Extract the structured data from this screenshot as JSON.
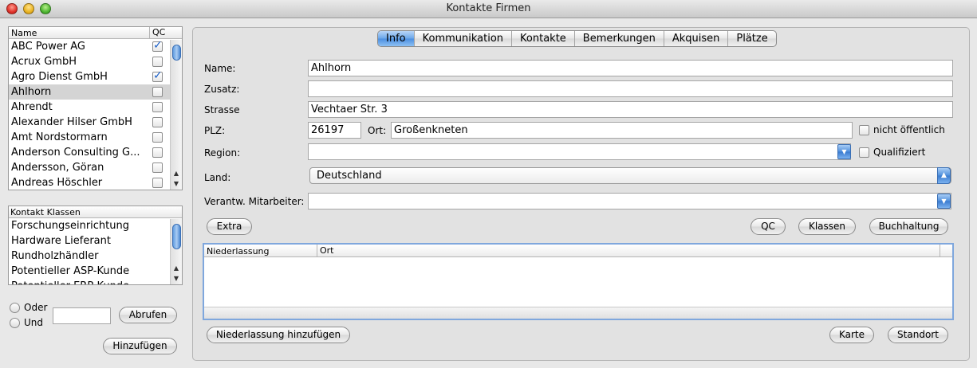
{
  "window": {
    "title": "Kontakte Firmen"
  },
  "companies": {
    "col_name": "Name",
    "col_qc": "QC",
    "rows": [
      {
        "name": "ABC Power AG",
        "qc": true,
        "selected": false
      },
      {
        "name": "Acrux GmbH",
        "qc": false,
        "selected": false
      },
      {
        "name": "Agro Dienst GmbH",
        "qc": true,
        "selected": false
      },
      {
        "name": "Ahlhorn",
        "qc": false,
        "selected": true
      },
      {
        "name": "Ahrendt",
        "qc": false,
        "selected": false
      },
      {
        "name": "Alexander Hilser GmbH",
        "qc": false,
        "selected": false
      },
      {
        "name": "Amt Nordstormarn",
        "qc": false,
        "selected": false
      },
      {
        "name": "Anderson Consulting G...",
        "qc": false,
        "selected": false
      },
      {
        "name": "Andersson, Göran",
        "qc": false,
        "selected": false
      },
      {
        "name": "Andreas Höschler",
        "qc": false,
        "selected": false
      }
    ]
  },
  "classes": {
    "header": "Kontakt Klassen",
    "rows": [
      "Forschungseinrichtung",
      "Hardware Lieferant",
      "Rundholzhändler",
      "Potentieller ASP-Kunde",
      "Potentieller ERP-Kunde"
    ]
  },
  "filter": {
    "oder": "Oder",
    "und": "Und",
    "abrufen": "Abrufen",
    "hinzufuegen": "Hinzufügen",
    "value": ""
  },
  "tabs": [
    "Info",
    "Kommunikation",
    "Kontakte",
    "Bemerkungen",
    "Akquisen",
    "Plätze"
  ],
  "form": {
    "name_label": "Name:",
    "name_value": "Ahlhorn",
    "zusatz_label": "Zusatz:",
    "zusatz_value": "",
    "strasse_label": "Strasse",
    "strasse_value": "Vechtaer Str. 3",
    "plz_label": "PLZ:",
    "plz_value": "26197",
    "ort_label": "Ort:",
    "ort_value": "Großenkneten",
    "nicht_oeffentlich": "nicht öffentlich",
    "region_label": "Region:",
    "region_value": "",
    "qualifiziert": "Qualifiziert",
    "land_label": "Land:",
    "land_value": "Deutschland",
    "mitarbeiter_label": "Verantw. Mitarbeiter:",
    "mitarbeiter_value": ""
  },
  "buttons": {
    "extra": "Extra",
    "qc": "QC",
    "klassen": "Klassen",
    "buchhaltung": "Buchhaltung",
    "niederlassung_hinzufuegen": "Niederlassung hinzufügen",
    "karte": "Karte",
    "standort": "Standort"
  },
  "branches": {
    "col_niederlassung": "Niederlassung",
    "col_ort": "Ort",
    "rows": []
  }
}
